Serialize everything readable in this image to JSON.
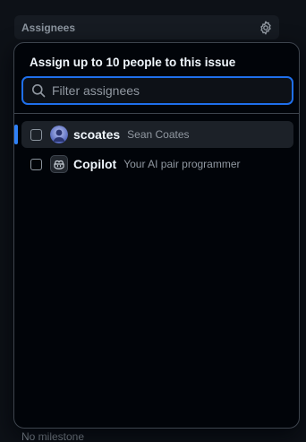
{
  "sidebar": {
    "assignees_label": "Assignees",
    "milestone_text": "No milestone"
  },
  "popover": {
    "title": "Assign up to 10 people to this issue",
    "filter": {
      "placeholder": "Filter assignees",
      "value": ""
    },
    "options": [
      {
        "name": "scoates",
        "description": "Sean Coates",
        "avatar": "user-avatar",
        "checked": false,
        "active": true
      },
      {
        "name": "Copilot",
        "description": "Your AI pair programmer",
        "avatar": "copilot-icon",
        "checked": false,
        "active": false
      }
    ]
  },
  "colors": {
    "background": "#0d1117",
    "popover_background": "#010409",
    "accent": "#1f6feb",
    "active_row": "#1c2128",
    "muted_text": "#8b949e"
  },
  "icons": {
    "settings": "gear-icon",
    "search": "search-icon"
  }
}
